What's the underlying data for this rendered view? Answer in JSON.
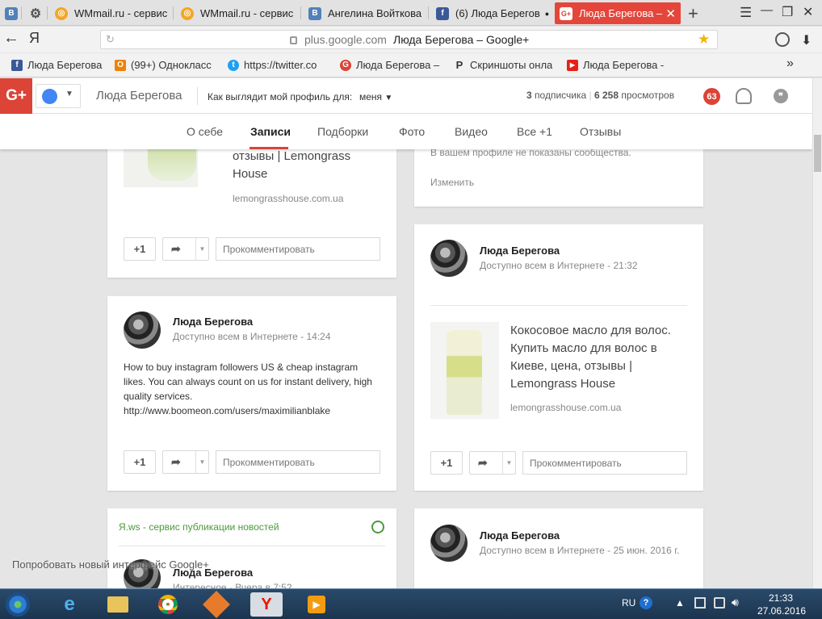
{
  "tabs": [
    {
      "label": "",
      "icon": "vk-icon",
      "color": "#5181b8",
      "glyph": "В"
    },
    {
      "label": "",
      "icon": "gear-icon",
      "color": "#555555",
      "glyph": "⚙"
    },
    {
      "label": "WMmail.ru - сервис",
      "icon": "wmmail-icon",
      "color": "#f5a623",
      "glyph": "◎"
    },
    {
      "label": "WMmail.ru - сервис",
      "icon": "wmmail-icon",
      "color": "#f5a623",
      "glyph": "◎"
    },
    {
      "label": "Ангелина Войткова",
      "icon": "vk-icon",
      "color": "#5181b8",
      "glyph": "В"
    },
    {
      "label": "(6) Люда Берегов",
      "icon": "facebook-icon",
      "color": "#3b5998",
      "glyph": "f"
    },
    {
      "label": "Люда Берегова –",
      "icon": "google-plus-icon",
      "color": "#db4437",
      "glyph": "G+"
    }
  ],
  "window_controls": {
    "menu": "☰",
    "minimize": "—",
    "restore": "❐",
    "close": "✕",
    "new_tab": "+"
  },
  "address": {
    "back": "←",
    "yandex": "Я",
    "reload": "↻",
    "domain": "plus.google.com",
    "title": "Люда Берегова – Google+",
    "star": "★",
    "download": "⬇"
  },
  "bookmarks": [
    {
      "label": "Люда Берегова",
      "icon": "facebook-icon",
      "color": "#3b5998",
      "glyph": "f"
    },
    {
      "label": "(99+) Однокласс",
      "icon": "odnoklassniki-icon",
      "color": "#ee8208",
      "glyph": "О"
    },
    {
      "label": "https://twitter.co",
      "icon": "twitter-icon",
      "color": "#1da1f2",
      "glyph": "t"
    },
    {
      "label": "Люда Берегова –",
      "icon": "google-plus-icon",
      "color": "#db4437",
      "glyph": "G"
    },
    {
      "label": "Скриншоты онла",
      "icon": "p-icon",
      "color": "#333333",
      "glyph": "P"
    },
    {
      "label": "Люда Берегова -",
      "icon": "youtube-icon",
      "color": "#e62117",
      "glyph": "▶"
    }
  ],
  "bookmarks_more": "»",
  "gheader": {
    "logo": "G+",
    "user_name": "Люда Берегова",
    "view_as_label": "Как выглядит мой профиль для:",
    "view_as_value": "меня",
    "followers_count": "3",
    "followers_label": "подписчика",
    "views_count": "6 258",
    "views_label": "просмотров",
    "notifications": "63"
  },
  "nav": [
    "О себе",
    "Записи",
    "Подборки",
    "Фото",
    "Видео",
    "Все +1",
    "Отзывы"
  ],
  "card1": {
    "title": "отзывы | Lemongrass\nHouse",
    "domain": "lemongrasshouse.com.ua",
    "plus": "+1",
    "comment": "Прокомментировать"
  },
  "card_communities": {
    "text": "В вашем профиле не показаны сообщества.",
    "edit": "Изменить"
  },
  "post2": {
    "name": "Люда Берегова",
    "visibility": "Доступно всем в Интернете",
    "time": "14:24",
    "text": "How to buy instagram followers US & cheap instagram likes. You can always count on us for instant delivery, high quality services.\nhttp://www.boomeon.com/users/maximilianblake",
    "plus": "+1",
    "comment": "Прокомментировать"
  },
  "post3": {
    "name": "Люда Берегова",
    "visibility": "Доступно всем в Интернете",
    "time": "21:32",
    "title": "Кокосовое масло для волос.\nКупить масло для волос в\nКиеве, цена, отзывы |\nLemongrass House",
    "domain": "lemongrasshouse.com.ua",
    "plus": "+1",
    "comment": "Прокомментировать"
  },
  "post4": {
    "source": "Я.ws - сервис публикации новостей",
    "name": "Люда Берегова",
    "visibility": "Интересное",
    "time": "Вчера в 7:52"
  },
  "post5": {
    "name": "Люда Берегова",
    "visibility": "Доступно всем в Интернете",
    "time": "25 июн. 2016 г."
  },
  "try_new": "Попробовать новый интерфейс Google+",
  "taskbar": {
    "lang": "RU",
    "time": "21:33",
    "date": "27.06.2016"
  },
  "colors": {
    "gplus_red": "#db4437",
    "active_tab": "#e4463b",
    "link_green": "#4a9a3a",
    "taskbar": "#1c3550"
  }
}
